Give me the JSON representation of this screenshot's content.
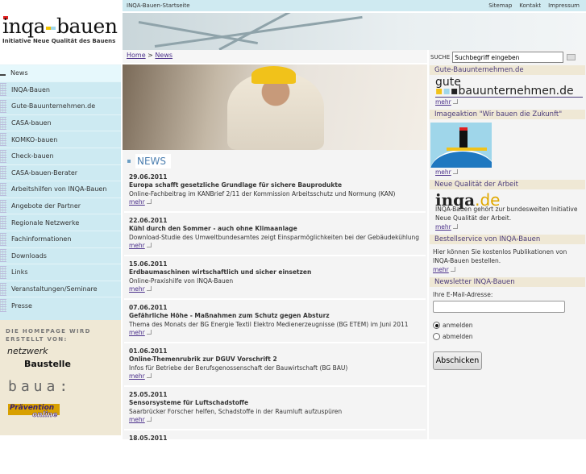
{
  "logo": {
    "word_a": "inqa",
    "word_b": "bauen",
    "tagline": "Initiative Neue Qualität des Bauens"
  },
  "topbar": {
    "home": "INQA-Bauen-Startseite",
    "links": [
      "Sitemap",
      "Kontakt",
      "Impressum"
    ]
  },
  "breadcrumb": {
    "home": "Home",
    "sep": ">",
    "current": "News"
  },
  "nav": [
    "News",
    "INQA-Bauen",
    "Gute-Bauunternehmen.de",
    "CASA-bauen",
    "KOMKO-bauen",
    "Check-bauen",
    "CASA-bauen-Berater",
    "Arbeitshilfen von INQA-Bauen",
    "Angebote der Partner",
    "Regionale Netzwerke",
    "Fachinformationen",
    "Downloads",
    "Links",
    "Veranstaltungen/Seminare",
    "Presse"
  ],
  "partners": {
    "heading": "DIE HOMEPAGE WIRD ERSTELLT VON:",
    "netzwerk": "netzwerk",
    "baustelle": "Baustelle",
    "baua": "baua:",
    "praevention": "Prävention",
    "online": "online"
  },
  "news": {
    "heading": "NEWS",
    "more": "mehr",
    "items": [
      {
        "date": "29.06.2011",
        "title": "Europa schafft gesetzliche Grundlage für sichere Bauprodukte",
        "text": "Online-Fachbeitrag im KANBrief 2/11 der Kommission Arbeitsschutz und Normung (KAN)"
      },
      {
        "date": "22.06.2011",
        "title": "Kühl durch den Sommer - auch ohne Klimaanlage",
        "text": "Download-Studie des Umweltbundesamtes zeigt Einsparmöglichkeiten bei der Gebäudekühlung"
      },
      {
        "date": "15.06.2011",
        "title": "Erdbaumaschinen wirtschaftlich und sicher einsetzen",
        "text": "Online-Praxishilfe von INQA-Bauen"
      },
      {
        "date": "07.06.2011",
        "title": "Gefährliche Höhe - Maßnahmen zum Schutz gegen Absturz",
        "text": "Thema des Monats der BG Energie Textil Elektro Medienerzeugnisse (BG ETEM) im Juni 2011"
      },
      {
        "date": "01.06.2011",
        "title": "Online-Themenrubrik zur DGUV Vorschrift 2",
        "text": "Infos für Betriebe der Berufsgenossenschaft der Bauwirtschaft (BG BAU)"
      },
      {
        "date": "25.05.2011",
        "title": "Sensorsysteme für Luftschadstoffe",
        "text": "Saarbrücker Forscher helfen, Schadstoffe in der Raumluft aufzuspüren"
      },
      {
        "date": "18.05.2011",
        "title": "",
        "text": ""
      }
    ]
  },
  "search": {
    "label": "SUCHE",
    "placeholder": "Suchbegriff eingeben"
  },
  "right": {
    "more": "mehr",
    "gute": {
      "title": "Gute-Bauunternehmen.de",
      "logo_a": "gute",
      "logo_b": "bauunternehmen.de"
    },
    "image": {
      "title": "Imageaktion \"Wir bauen die Zukunft\""
    },
    "nqa": {
      "title": "Neue Qualität der Arbeit",
      "logo_a": "inqa",
      "logo_b": ".de",
      "text": "INQA-Bauen gehört zur bundesweiten Initiative Neue Qualität der Arbeit."
    },
    "order": {
      "title": "Bestellservice von INQA-Bauen",
      "text": "Hier können Sie kostenlos Publikationen von INQA-Bauen bestellen."
    },
    "newsletter": {
      "title": "Newsletter INQA-Bauen",
      "email_label": "Ihre E-Mail-Adresse:",
      "email_value": "",
      "opt_in": "anmelden",
      "opt_out": "abmelden",
      "selected": "anmelden",
      "submit": "Abschicken"
    }
  }
}
